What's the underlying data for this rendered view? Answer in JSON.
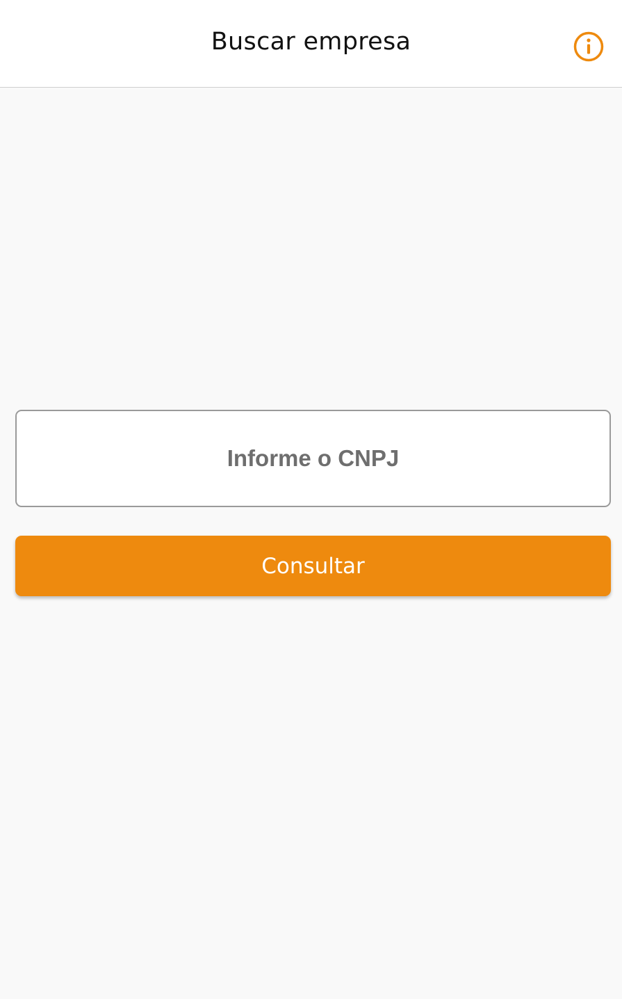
{
  "app_bar": {
    "title": "Buscar empresa",
    "info_icon": "info-circle-icon"
  },
  "search": {
    "placeholder": "Informe o CNPJ",
    "value": ""
  },
  "actions": {
    "consult_label": "Consultar"
  },
  "colors": {
    "accent": "#ee8a0e",
    "background": "#f9f9f9",
    "header_background": "#ffffff"
  }
}
